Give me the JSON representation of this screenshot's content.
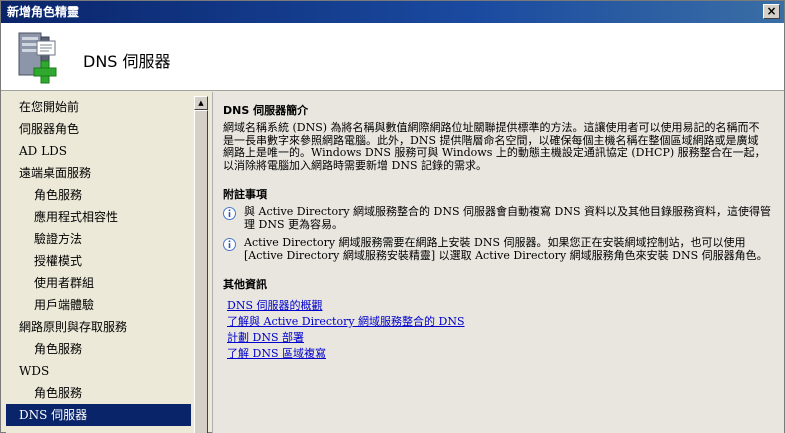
{
  "window": {
    "title": "新增角色精靈",
    "close_label": "×"
  },
  "header": {
    "title": "DNS 伺服器"
  },
  "sidebar": {
    "items": [
      {
        "label": "在您開始前",
        "level": 0
      },
      {
        "label": "伺服器角色",
        "level": 0
      },
      {
        "label": "AD LDS",
        "level": 0
      },
      {
        "label": "遠端桌面服務",
        "level": 0
      },
      {
        "label": "角色服務",
        "level": 1
      },
      {
        "label": "應用程式相容性",
        "level": 1
      },
      {
        "label": "驗證方法",
        "level": 1
      },
      {
        "label": "授權模式",
        "level": 1
      },
      {
        "label": "使用者群組",
        "level": 1
      },
      {
        "label": "用戶端體驗",
        "level": 1
      },
      {
        "label": "網路原則與存取服務",
        "level": 0
      },
      {
        "label": "角色服務",
        "level": 1
      },
      {
        "label": "WDS",
        "level": 0
      },
      {
        "label": "角色服務",
        "level": 1
      },
      {
        "label": "DNS 伺服器",
        "level": 0,
        "active": true
      }
    ]
  },
  "content": {
    "intro_title": "DNS 伺服器簡介",
    "intro_text": "網域名稱系統 (DNS) 為將名稱與數值網際網路位址關聯提供標準的方法。這讓使用者可以使用易記的名稱而不是一長串數字來參照網路電腦。此外，DNS 提供階層命名空間，以確保每個主機名稱在整個區域網路或是廣域網路上是唯一的。Windows DNS 服務可與 Windows 上的動態主機設定通訊協定 (DHCP) 服務整合在一起，以消除將電腦加入網路時需要新增 DNS 記錄的需求。",
    "notes_title": "附註事項",
    "notes": [
      "與 Active Directory 網域服務整合的 DNS 伺服器會自動複寫 DNS 資料以及其他目錄服務資料，這使得管理 DNS 更為容易。",
      "Active Directory 網域服務需要在網路上安裝 DNS 伺服器。如果您正在安裝網域控制站，也可以使用 [Active Directory 網域服務安裝精靈] 以選取 Active Directory 網域服務角色來安裝 DNS 伺服器角色。"
    ],
    "more_title": "其他資訊",
    "links": [
      "DNS 伺服器的概觀",
      "了解與 Active Directory 網域服務整合的 DNS",
      "計劃 DNS 部署",
      "了解 DNS 區域複寫"
    ]
  },
  "colors": {
    "title_bar": "#0a246a",
    "selection": "#0a246a",
    "link": "#0000cc",
    "content_bg": "#e8e6df"
  }
}
